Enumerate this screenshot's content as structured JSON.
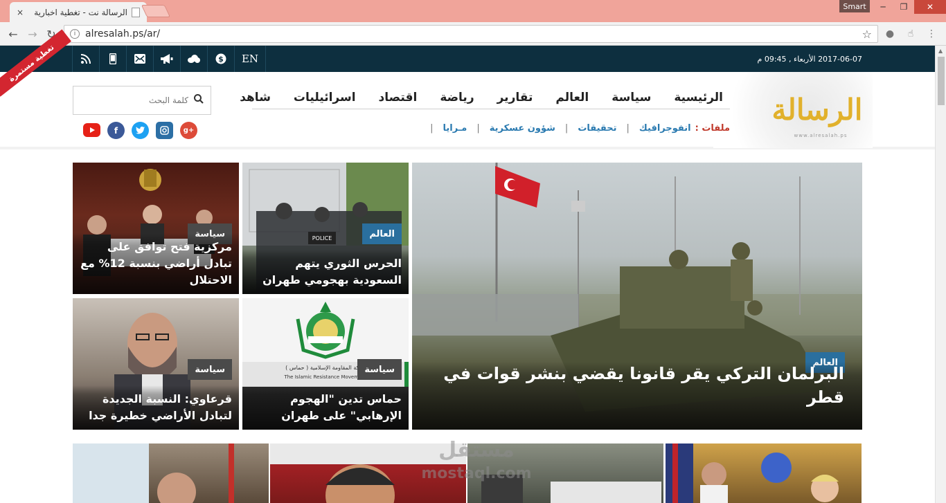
{
  "browser": {
    "tab_title": "الرسالة نت - تغطية اخبارية",
    "tab_close": "×",
    "url": "alresalah.ps/ar/",
    "profile_badge": "Smart",
    "window_min": "─",
    "window_max": "❐",
    "window_close": "✕"
  },
  "topbar": {
    "ribbon": "تغطية مستمرة",
    "datetime": "2017-06-07 الأربعاء , 09:45 م",
    "lang_toggle": "EN"
  },
  "header": {
    "logo_text": "الرسالة",
    "logo_url": "www.alresalah.ps",
    "nav": [
      "الرئيسية",
      "سياسة",
      "العالم",
      "تقارير",
      "رياضة",
      "اقتصاد",
      "اسرائيليات",
      "شاهد"
    ],
    "files_label": "ملفات :",
    "sub_nav": [
      "انفوجرافيك",
      "تحقيقات",
      "شؤون عسكرية",
      "مـرايا"
    ],
    "search_placeholder": "كلمة البحث"
  },
  "cards": {
    "big": {
      "category": "العالم",
      "title": "البرلمان التركي يقر قانونا يقضي بنشر قوات في قطر"
    },
    "c1": {
      "category": "العالم",
      "title": "الحرس الثوري يتهم السعودية بهجومي طهران"
    },
    "c2": {
      "category": "سياسة",
      "title": "مركزية فتح توافق على تبادل أراضي بنسبة 12% مع الاحتلال"
    },
    "c3": {
      "category": "سياسة",
      "title": "حماس تدين \"الهجوم الإرهابي\" على طهران",
      "image_text_ar": "حركة المقاومة الإسلامية ( حماس )",
      "image_text_en": "The Islamic Resistance Movement"
    },
    "c4": {
      "category": "سياسة",
      "title": "قرعاوي: النسبة الجديدة لتبادل الأراضي خطيرة جدا"
    }
  },
  "watermark": {
    "ar": "مستقل",
    "en": "mostaql.com"
  },
  "colors": {
    "topbar": "#0d2f3f",
    "ribbon": "#d32630",
    "world_badge": "#2a6f9e",
    "logo": "#e1b12c",
    "files": "#c0392b",
    "sub_link": "#2a7ab0"
  }
}
